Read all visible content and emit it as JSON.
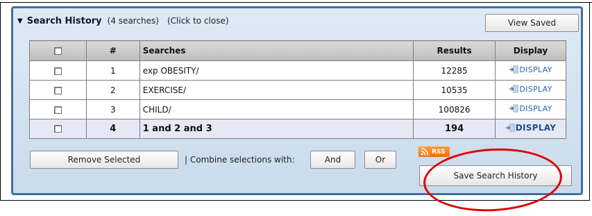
{
  "panel": {
    "title": "Search History",
    "count_text": "(4 searches)",
    "hint_text": "(Click to close)",
    "view_saved_label": "View Saved"
  },
  "table": {
    "headers": {
      "checkbox": "",
      "number": "#",
      "searches": "Searches",
      "results": "Results",
      "display": "Display"
    },
    "rows": [
      {
        "number": "1",
        "query": "exp OBESITY/",
        "results": "12285",
        "display": "DISPLAY",
        "checked": false
      },
      {
        "number": "2",
        "query": "EXERCISE/",
        "results": "10535",
        "display": "DISPLAY",
        "checked": false
      },
      {
        "number": "3",
        "query": "CHILD/",
        "results": "100826",
        "display": "DISPLAY",
        "checked": false
      },
      {
        "number": "4",
        "query": "1 and 2 and 3",
        "results": "194",
        "display": "DISPLAY",
        "checked": false
      }
    ]
  },
  "controls": {
    "remove_label": "Remove Selected",
    "combine_label": "| Combine selections with:",
    "and_label": "And",
    "or_label": "Or",
    "rss_label": "RSS",
    "save_label": "Save Search History"
  },
  "colors": {
    "panel_border": "#3f6fa6",
    "panel_bg": "#dfeaf5",
    "link": "#2766a8",
    "annotation": "#e00000",
    "rss": "#f08a2a"
  }
}
